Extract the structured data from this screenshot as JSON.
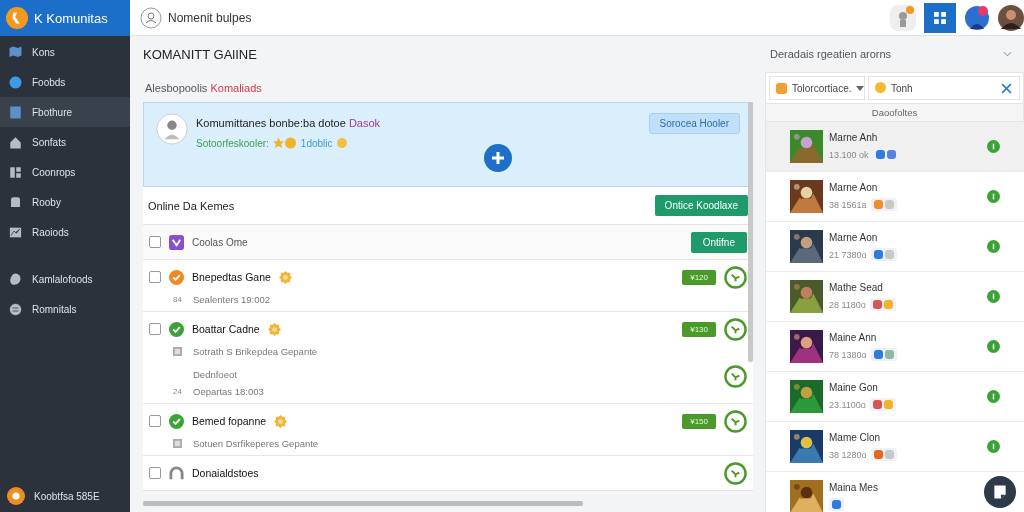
{
  "brand": {
    "name": "K Komunitas"
  },
  "topbar": {
    "title": "Nomenit bulpes"
  },
  "sidebar": {
    "items": [
      {
        "label": "Kons",
        "selected": false
      },
      {
        "label": "Foobds",
        "selected": false
      },
      {
        "label": "Fbothure",
        "selected": true
      },
      {
        "label": "Sonfats",
        "selected": false
      },
      {
        "label": "Coonrops",
        "selected": false
      },
      {
        "label": "Rooby",
        "selected": false
      },
      {
        "label": "Raoiods",
        "selected": false
      }
    ],
    "extra_items": [
      {
        "label": "Kamlalofoods",
        "selected": false
      },
      {
        "label": "Romnitals",
        "selected": false
      }
    ],
    "footer": "Koobtfsa 585E"
  },
  "page": {
    "title": "KOMANITT GAlINE",
    "subtitle": "Alesbopoolis",
    "subtitle_highlight": "Komaliads"
  },
  "card": {
    "title": "Komumittanes bonbe:ba dotoe",
    "title_highlight": "Dasok",
    "status": "Sotoorfeskooler:",
    "link": "1doblic",
    "button": "Sorocea Hooler"
  },
  "list": {
    "title": "Online Da Kemes",
    "button": "Ontice Koodlaxe",
    "header": {
      "label": "Coolas Ome",
      "checked": false,
      "button": "Ontifne"
    },
    "rows": [
      {
        "title": "Bnepedtas Gane",
        "kind": "pending",
        "checked": false,
        "tag": "¥120",
        "lines": [
          {
            "kind": "numbered",
            "prefix": "84",
            "text": "Sealenters 19:002"
          }
        ]
      },
      {
        "title": "Boattar Cadne",
        "kind": "done",
        "checked": false,
        "tag": "¥130",
        "lines": [
          {
            "kind": "calendar",
            "text": "Sotrath S Brikepdea  Gepante"
          },
          {
            "kind": "plain",
            "text": "Dednfoeot"
          },
          {
            "kind": "numbered",
            "prefix": "24",
            "text": "Oepartas 18:003"
          }
        ]
      },
      {
        "title": "Bemed fopanne",
        "kind": "done",
        "checked": false,
        "tag": "¥150",
        "lines": [
          {
            "kind": "calendar",
            "text": "Sotuen Dsrfikeperes  Gepante"
          }
        ]
      },
      {
        "title": "Donaialdstoes",
        "kind": "other",
        "checked": false,
        "lines": []
      }
    ]
  },
  "panel": {
    "title": "Deradais rgeatien arorns",
    "dropdown": "Tolorcortiace.",
    "search": {
      "value": "Tonh"
    },
    "section": "Daoofoltes",
    "items": [
      {
        "name": "Marne Anh",
        "meta": "13.100 ok",
        "selected": true,
        "tags": [
          {
            "color": "#2d7be0"
          },
          {
            "color": "#5b7fe0"
          }
        ]
      },
      {
        "name": "Marne Aon",
        "meta": "38 1561a",
        "selected": false,
        "tags": [
          {
            "color": "#f08c2a"
          },
          {
            "color": "#c8c8c8"
          }
        ]
      },
      {
        "name": "Marne Aon",
        "meta": "21 7380o",
        "selected": false,
        "tags": [
          {
            "color": "#2d7be0"
          },
          {
            "color": "#c8c8c8"
          }
        ]
      },
      {
        "name": "Mathe Sead",
        "meta": "28 1180o",
        "selected": false,
        "tags": [
          {
            "color": "#d9534f"
          },
          {
            "color": "#f0b429"
          }
        ]
      },
      {
        "name": "Maine Ann",
        "meta": "78 1380o",
        "selected": false,
        "tags": [
          {
            "color": "#2d7be0"
          },
          {
            "color": "#8fb8a0"
          }
        ]
      },
      {
        "name": "Maine Gon",
        "meta": "23.1100o",
        "selected": false,
        "tags": [
          {
            "color": "#d9534f"
          },
          {
            "color": "#f0b429"
          }
        ]
      },
      {
        "name": "Mame Clon",
        "meta": "38 1280o",
        "selected": false,
        "tags": [
          {
            "color": "#e06a1a"
          },
          {
            "color": "#c8c8c8"
          }
        ]
      },
      {
        "name": "Maina Mes",
        "selected": false,
        "tags": [
          {
            "color": "#2d7be0"
          }
        ]
      }
    ]
  }
}
